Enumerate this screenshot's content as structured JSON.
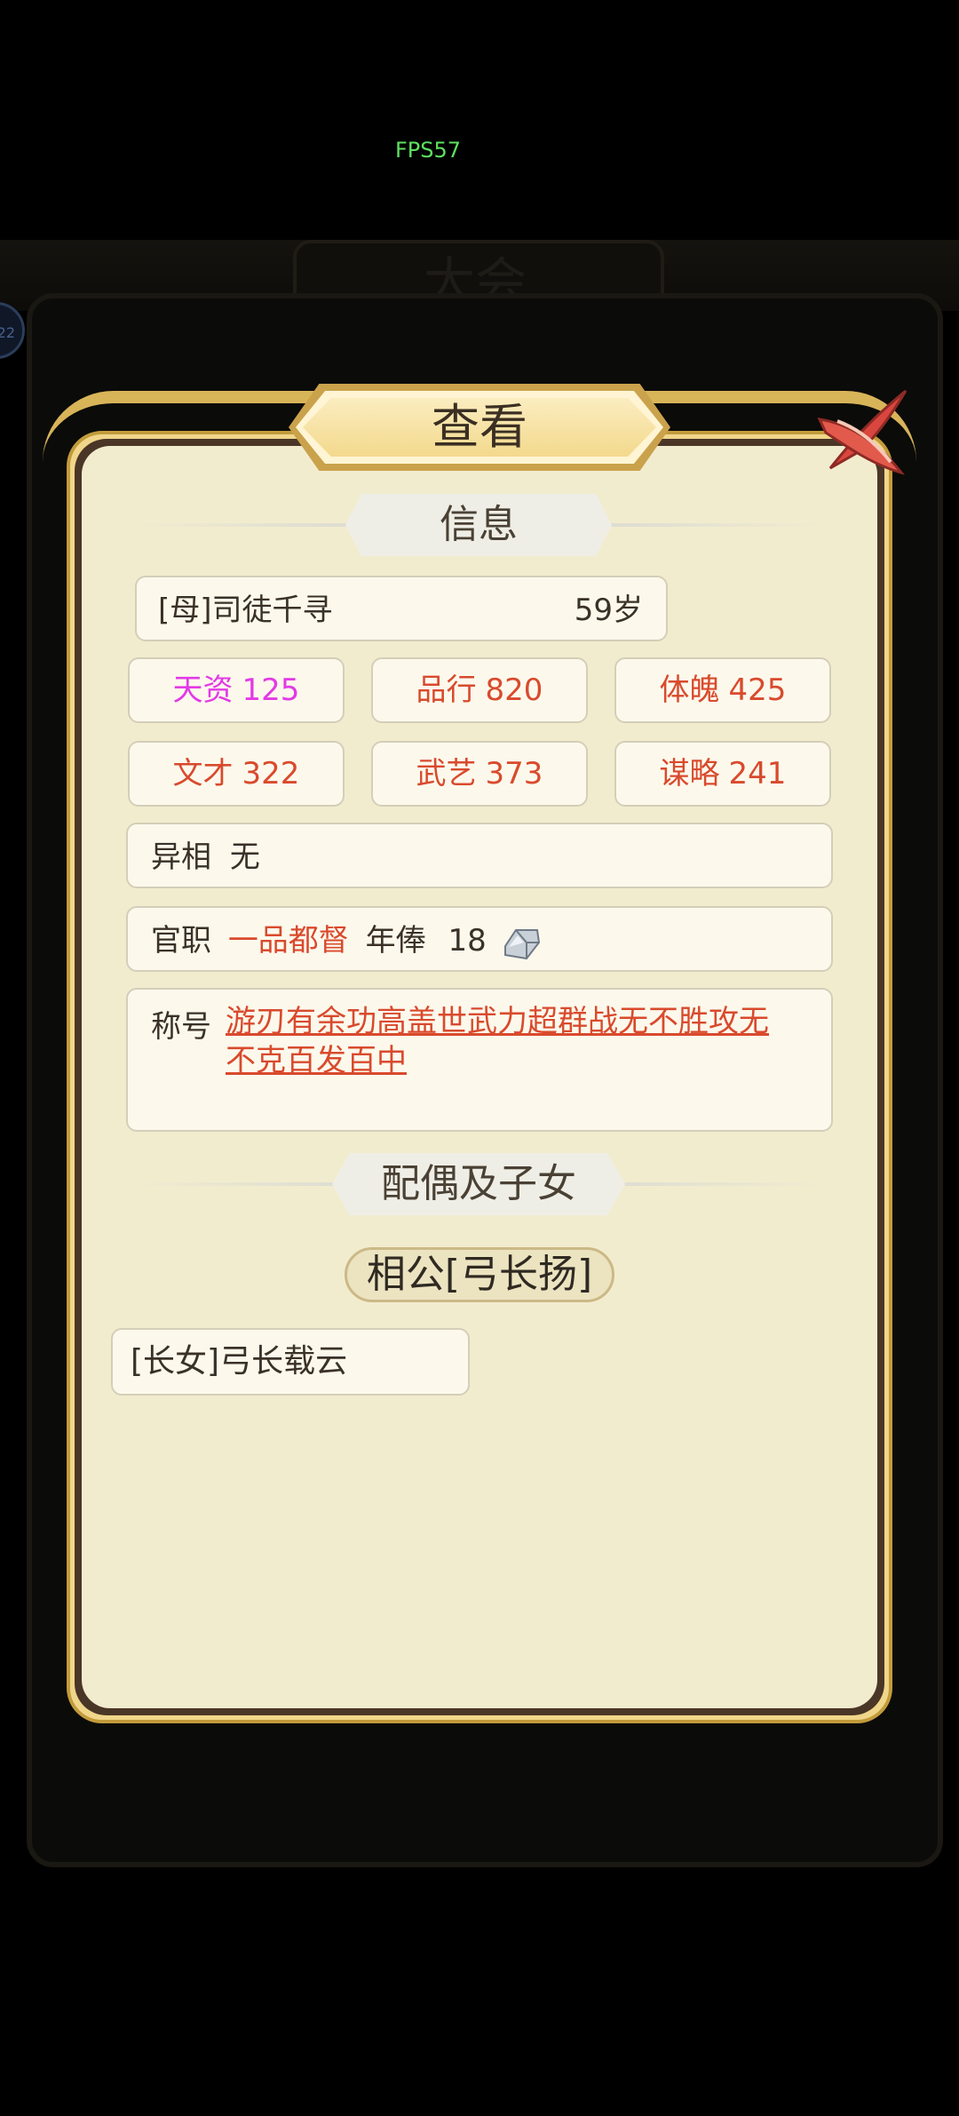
{
  "overlay": {
    "fps": "FPS57",
    "background_title": "大会",
    "avatar_text": "22"
  },
  "dialog": {
    "title": "查看"
  },
  "info": {
    "section_title": "信息",
    "name": "[母]司徒千寻",
    "age": "59岁",
    "stats": [
      {
        "label": "天资",
        "value": "125"
      },
      {
        "label": "品行",
        "value": "820"
      },
      {
        "label": "体魄",
        "value": "425"
      },
      {
        "label": "文才",
        "value": "322"
      },
      {
        "label": "武艺",
        "value": "373"
      },
      {
        "label": "谋略",
        "value": "241"
      }
    ],
    "feature_label": "异相",
    "feature_value": "无",
    "office_label": "官职",
    "office_value": "一品都督",
    "salary_label": "年俸",
    "salary_value": "18",
    "title_label": "称号",
    "titles_text": "游刃有余功高盖世武力超群战无不胜攻无不克百发百中"
  },
  "family": {
    "section_title": "配偶及子女",
    "spouse": "相公[弓长扬]",
    "children": [
      "[长女]弓长载云"
    ]
  },
  "colors": {
    "accent_red": "#d94a2d",
    "accent_pink": "#e33ae6",
    "gold": "#d8b459"
  },
  "icons": {
    "close": "close-x-icon",
    "salary": "silver-ingot-icon"
  }
}
